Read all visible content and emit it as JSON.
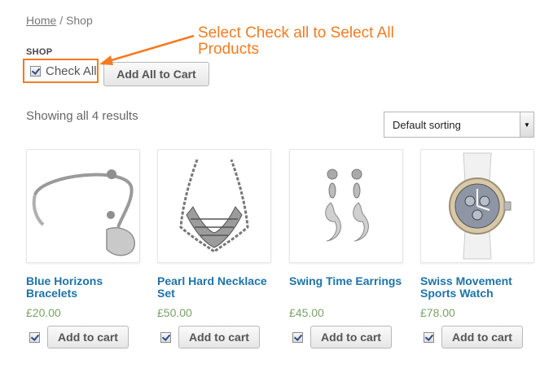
{
  "breadcrumb": {
    "home": "Home",
    "separator": " / ",
    "current": "Shop"
  },
  "shop_title": "SHOP",
  "check_all": {
    "label": "Check All",
    "checked": true
  },
  "add_all_button": "Add All to Cart",
  "annotation": {
    "text": "Select Check all to Select All Products",
    "color": "#f47b20"
  },
  "results_text": "Showing all 4 results",
  "sorting": {
    "selected": "Default sorting"
  },
  "products": [
    {
      "name": "Blue Horizons Bracelets",
      "price": "£20.00",
      "cart_label": "Add to cart",
      "checked": true,
      "image": "bracelet"
    },
    {
      "name": "Pearl Hard Necklace Set",
      "price": "£50.00",
      "cart_label": "Add to cart",
      "checked": true,
      "image": "necklace"
    },
    {
      "name": "Swing Time Earrings",
      "price": "£45.00",
      "cart_label": "Add to cart",
      "checked": true,
      "image": "earrings"
    },
    {
      "name": "Swiss Movement Sports Watch",
      "price": "£78.00",
      "cart_label": "Add to cart",
      "checked": true,
      "image": "watch"
    }
  ],
  "colors": {
    "link": "#1e73a8",
    "price": "#77a464",
    "accent": "#f47b20"
  }
}
